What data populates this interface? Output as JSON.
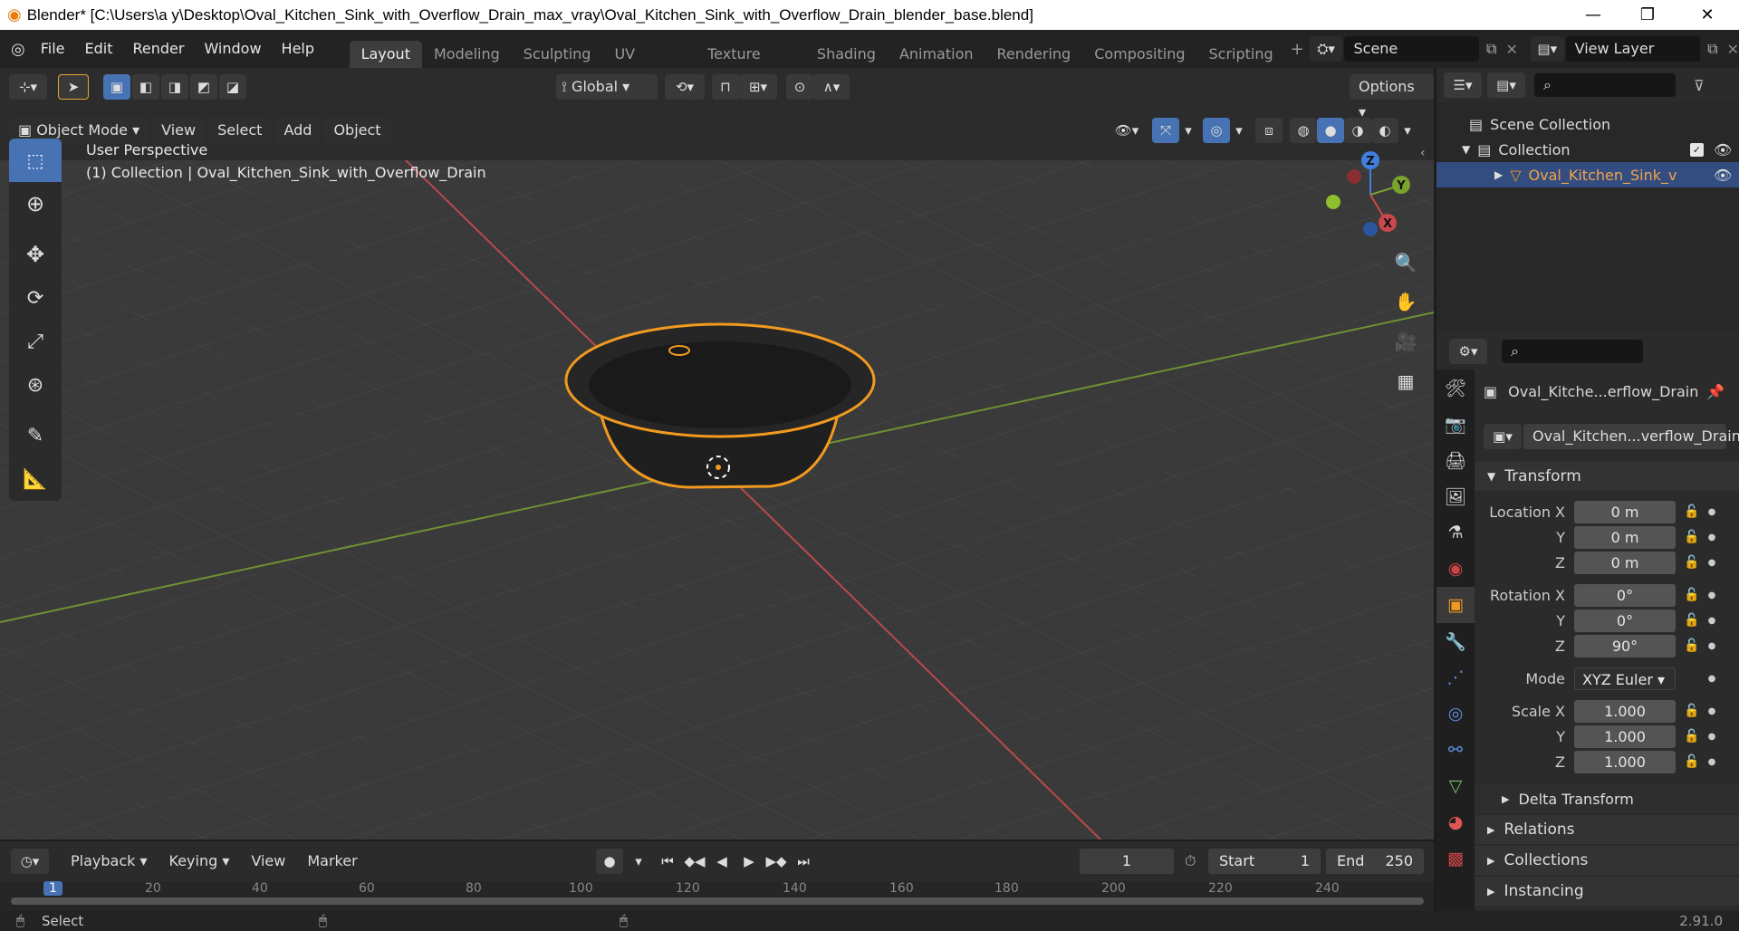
{
  "window": {
    "title": "Blender* [C:\\Users\\a y\\Desktop\\Oval_Kitchen_Sink_with_Overflow_Drain_max_vray\\Oval_Kitchen_Sink_with_Overflow_Drain_blender_base.blend]"
  },
  "menu": {
    "items": [
      "File",
      "Edit",
      "Render",
      "Window",
      "Help"
    ]
  },
  "workspaces": [
    "Layout",
    "Modeling",
    "Sculpting",
    "UV Editing",
    "Texture Paint",
    "Shading",
    "Animation",
    "Rendering",
    "Compositing",
    "Scripting"
  ],
  "scene": {
    "name": "Scene",
    "view_layer": "View Layer"
  },
  "header": {
    "transform_orientation": "Global",
    "options_label": "Options"
  },
  "viewport": {
    "mode": "Object Mode",
    "menus": [
      "View",
      "Select",
      "Add",
      "Object"
    ],
    "overlay_line1": "User Perspective",
    "overlay_line2": "(1) Collection | Oval_Kitchen_Sink_with_Overflow_Drain",
    "gizmo": {
      "x": "X",
      "y": "Y",
      "z": "Z"
    }
  },
  "outliner": {
    "scene_collection": "Scene Collection",
    "collection": "Collection",
    "object": "Oval_Kitchen_Sink_v"
  },
  "properties": {
    "object_name": "Oval_Kitche...erflow_Drain",
    "data_name": "Oval_Kitchen...verflow_Drain",
    "transform_label": "Transform",
    "location_label": "Location X",
    "rotation_label": "Rotation X",
    "scale_label": "Scale X",
    "y_label": "Y",
    "z_label": "Z",
    "mode_label": "Mode",
    "location": {
      "x": "0 m",
      "y": "0 m",
      "z": "0 m"
    },
    "rotation": {
      "x": "0°",
      "y": "0°",
      "z": "90°"
    },
    "rotation_mode": "XYZ Euler",
    "scale": {
      "x": "1.000",
      "y": "1.000",
      "z": "1.000"
    },
    "sections": [
      "Delta Transform",
      "Relations",
      "Collections",
      "Instancing"
    ]
  },
  "timeline": {
    "menus": [
      "Playback",
      "Keying",
      "View",
      "Marker"
    ],
    "current_frame": "1",
    "start_label": "Start",
    "start": "1",
    "end_label": "End",
    "end": "250",
    "ruler": [
      "1",
      "20",
      "40",
      "60",
      "80",
      "100",
      "120",
      "140",
      "160",
      "180",
      "200",
      "220",
      "240"
    ]
  },
  "status": {
    "left": "Select",
    "version": "2.91.0"
  },
  "colors": {
    "accent": "#4772b3",
    "selection": "#f29a1f",
    "x_axis": "#c8484c",
    "y_axis": "#7aa22e",
    "z_axis": "#3f7fe0"
  }
}
